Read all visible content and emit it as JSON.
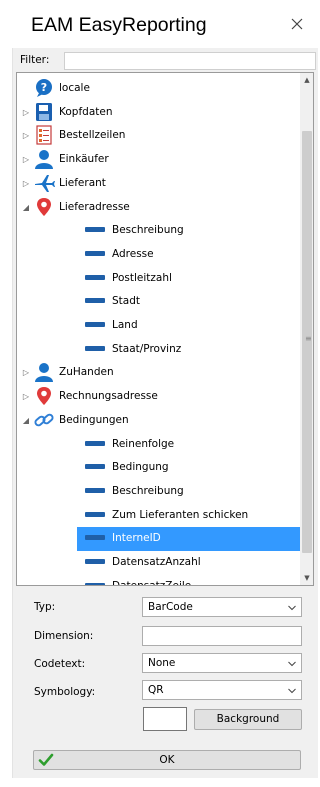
{
  "window": {
    "title": "EAM EasyReporting",
    "close_icon": "close-icon"
  },
  "filter": {
    "label": "Filter:",
    "value": ""
  },
  "tree": {
    "items": [
      {
        "label": "locale",
        "icon": "help-bubble-icon",
        "expander": "",
        "level": 0
      },
      {
        "label": "Kopfdaten",
        "icon": "floppy-disk-icon",
        "expander": "collapsed",
        "level": 0
      },
      {
        "label": "Bestellzeilen",
        "icon": "order-lines-icon",
        "expander": "collapsed",
        "level": 0
      },
      {
        "label": "Einkäufer",
        "icon": "person-icon",
        "expander": "collapsed",
        "level": 0
      },
      {
        "label": "Lieferant",
        "icon": "airplane-icon",
        "expander": "collapsed",
        "level": 0
      },
      {
        "label": "Lieferadresse",
        "icon": "map-pin-icon",
        "expander": "expanded",
        "level": 0
      },
      {
        "label": "Beschreibung",
        "icon": "field-icon",
        "expander": "",
        "level": 1
      },
      {
        "label": "Adresse",
        "icon": "field-icon",
        "expander": "",
        "level": 1
      },
      {
        "label": "Postleitzahl",
        "icon": "field-icon",
        "expander": "",
        "level": 1
      },
      {
        "label": "Stadt",
        "icon": "field-icon",
        "expander": "",
        "level": 1
      },
      {
        "label": "Land",
        "icon": "field-icon",
        "expander": "",
        "level": 1
      },
      {
        "label": "Staat/Provinz",
        "icon": "field-icon",
        "expander": "",
        "level": 1
      },
      {
        "label": "ZuHanden",
        "icon": "person-icon",
        "expander": "collapsed",
        "level": 0
      },
      {
        "label": "Rechnungsadresse",
        "icon": "map-pin-icon",
        "expander": "collapsed",
        "level": 0
      },
      {
        "label": "Bedingungen",
        "icon": "chain-link-icon",
        "expander": "expanded",
        "level": 0
      },
      {
        "label": "Reinenfolge",
        "icon": "field-icon",
        "expander": "",
        "level": 1
      },
      {
        "label": "Bedingung",
        "icon": "field-icon",
        "expander": "",
        "level": 1
      },
      {
        "label": "Beschreibung",
        "icon": "field-icon",
        "expander": "",
        "level": 1
      },
      {
        "label": "Zum Lieferanten schicken",
        "icon": "field-icon",
        "expander": "",
        "level": 1
      },
      {
        "label": "InterneID",
        "icon": "field-icon",
        "expander": "",
        "level": 1,
        "selected": true
      },
      {
        "label": "DatensatzAnzahl",
        "icon": "field-icon",
        "expander": "",
        "level": 1
      },
      {
        "label": "DatensatzZeile",
        "icon": "field-icon",
        "expander": "",
        "level": 1
      }
    ]
  },
  "properties": {
    "typ_label": "Typ:",
    "typ_value": "BarCode",
    "dimension_label": "Dimension:",
    "dimension_value": "",
    "codetext_label": "Codetext:",
    "codetext_value": "None",
    "symbology_label": "Symbology:",
    "symbology_value": "QR",
    "background_label": "Background"
  },
  "ok_label": "OK",
  "colors": {
    "selection": "#3399ff",
    "field_icon": "#1f5fa8",
    "pin_red": "#e03a3a",
    "person_blue": "#1a73c8",
    "check_green": "#2e9e2e"
  }
}
